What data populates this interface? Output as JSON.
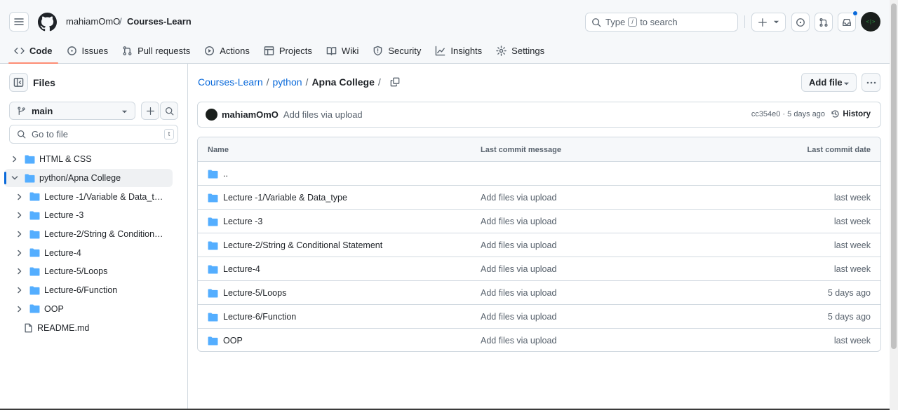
{
  "header": {
    "owner": "mahiamOmO",
    "slash": "/",
    "repo": "Courses-Learn",
    "search_prefix": "Type",
    "search_key": "/",
    "search_suffix": "to search",
    "avatar_text": "<|>"
  },
  "tabs": [
    {
      "label": "Code",
      "icon": "code-icon"
    },
    {
      "label": "Issues",
      "icon": "issue-icon"
    },
    {
      "label": "Pull requests",
      "icon": "pull-request-icon"
    },
    {
      "label": "Actions",
      "icon": "play-icon"
    },
    {
      "label": "Projects",
      "icon": "table-icon"
    },
    {
      "label": "Wiki",
      "icon": "book-icon"
    },
    {
      "label": "Security",
      "icon": "shield-icon"
    },
    {
      "label": "Insights",
      "icon": "graph-icon"
    },
    {
      "label": "Settings",
      "icon": "gear-icon"
    }
  ],
  "sidebar": {
    "title": "Files",
    "branch": "main",
    "goto_placeholder": "Go to file",
    "goto_key": "t",
    "tree": [
      {
        "label": "HTML & CSS",
        "type": "folder",
        "level": 0,
        "expanded": false
      },
      {
        "label": "python/Apna College",
        "type": "folder",
        "level": 0,
        "expanded": true,
        "selected": true
      },
      {
        "label": "Lecture -1/Variable & Data_type",
        "type": "folder",
        "level": 1
      },
      {
        "label": "Lecture -3",
        "type": "folder",
        "level": 1
      },
      {
        "label": "Lecture-2/String & Conditional ...",
        "type": "folder",
        "level": 1
      },
      {
        "label": "Lecture-4",
        "type": "folder",
        "level": 1
      },
      {
        "label": "Lecture-5/Loops",
        "type": "folder",
        "level": 1
      },
      {
        "label": "Lecture-6/Function",
        "type": "folder",
        "level": 1
      },
      {
        "label": "OOP",
        "type": "folder",
        "level": 1
      },
      {
        "label": "README.md",
        "type": "file",
        "level": 0
      }
    ]
  },
  "path": {
    "repo": "Courses-Learn",
    "folder": "python",
    "current": "Apna College",
    "sep": "/"
  },
  "buttons": {
    "add_file": "Add file"
  },
  "commit": {
    "author": "mahiamOmO",
    "message": "Add files via upload",
    "meta": "cc354e0 · 5 days ago",
    "history": "History"
  },
  "table": {
    "headers": {
      "name": "Name",
      "message": "Last commit message",
      "date": "Last commit date"
    },
    "parent": "..",
    "rows": [
      {
        "name": "Lecture -1/Variable & Data_type",
        "message": "Add files via upload",
        "date": "last week"
      },
      {
        "name": "Lecture -3",
        "message": "Add files via upload",
        "date": "last week"
      },
      {
        "name": "Lecture-2/String & Conditional Statement",
        "message": "Add files via upload",
        "date": "last week"
      },
      {
        "name": "Lecture-4",
        "message": "Add files via upload",
        "date": "last week"
      },
      {
        "name": "Lecture-5/Loops",
        "message": "Add files via upload",
        "date": "5 days ago"
      },
      {
        "name": "Lecture-6/Function",
        "message": "Add files via upload",
        "date": "5 days ago"
      },
      {
        "name": "OOP",
        "message": "Add files via upload",
        "date": "last week"
      }
    ]
  },
  "colors": {
    "link": "#0969da",
    "folder": "#54aeff",
    "tab_underline": "#fd8c73",
    "border": "#d1d9e0"
  }
}
